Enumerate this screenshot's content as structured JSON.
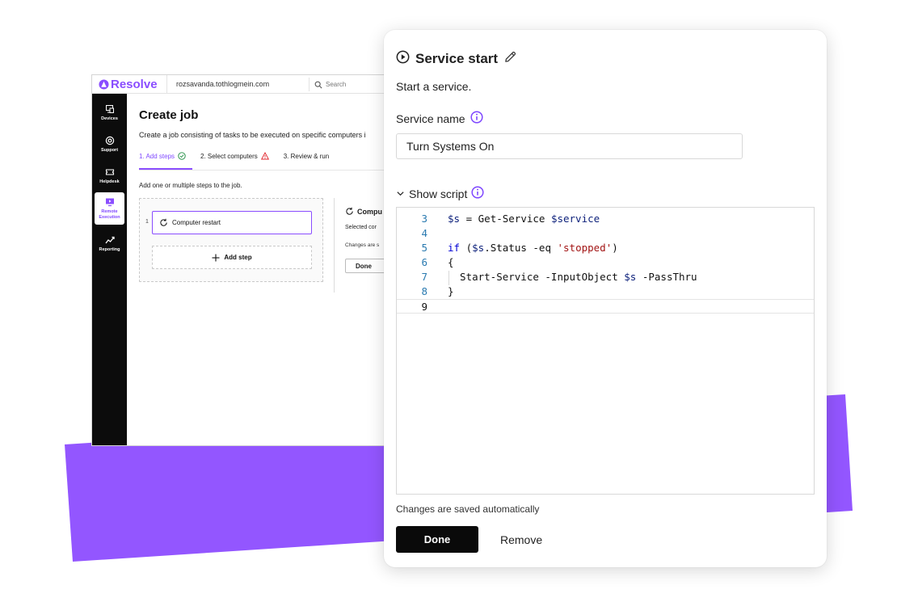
{
  "colors": {
    "accent": "#8a4dff",
    "slab": "#9356ff",
    "sidebar_bg": "#0c0c0c",
    "warning": "#e0242b",
    "success": "#1a8a3d",
    "done_button": "#0a0a0a"
  },
  "background_app": {
    "logo": "Resolve",
    "account": "rozsavanda.tothlogmein.com",
    "search_placeholder": "Search",
    "sidebar": [
      {
        "label": "Devices",
        "icon": "devices-icon"
      },
      {
        "label": "Support",
        "icon": "support-icon"
      },
      {
        "label": "Helpdesk",
        "icon": "ticket-icon"
      },
      {
        "label": "Remote Execution",
        "icon": "remote-execution-icon",
        "active": true
      },
      {
        "label": "Reporting",
        "icon": "reporting-icon"
      }
    ],
    "page_title": "Create job",
    "page_description": "Create a job consisting of tasks to be executed on specific computers i",
    "steps_nav": [
      {
        "label": "1. Add steps",
        "status": "check-circle-icon",
        "active": true
      },
      {
        "label": "2. Select computers",
        "status": "warning-icon"
      },
      {
        "label": "3. Review & run"
      }
    ],
    "steps_hint": "Add one or multiple steps to the job.",
    "step_number": "1",
    "step_card_label": "Computer restart",
    "add_step_label": "Add step",
    "detail_title": "Compu",
    "detail_subtitle": "Selected cor",
    "detail_changes": "Changes are s",
    "detail_done": "Done"
  },
  "panel": {
    "title": "Service start",
    "description": "Start a service.",
    "service_name_label": "Service name",
    "service_name_value": "Turn Systems On",
    "show_script_label": "Show script",
    "code_lines": [
      {
        "n": "3",
        "text": "$s = Get-Service $service"
      },
      {
        "n": "4",
        "text": ""
      },
      {
        "n": "5",
        "text": "if ($s.Status -eq 'stopped')"
      },
      {
        "n": "6",
        "text": "{"
      },
      {
        "n": "7",
        "text": "  Start-Service -InputObject $s -PassThru"
      },
      {
        "n": "8",
        "text": "}"
      },
      {
        "n": "9",
        "text": ""
      }
    ],
    "current_line": "9",
    "autosave_text": "Changes are saved automatically",
    "done_label": "Done",
    "remove_label": "Remove"
  }
}
